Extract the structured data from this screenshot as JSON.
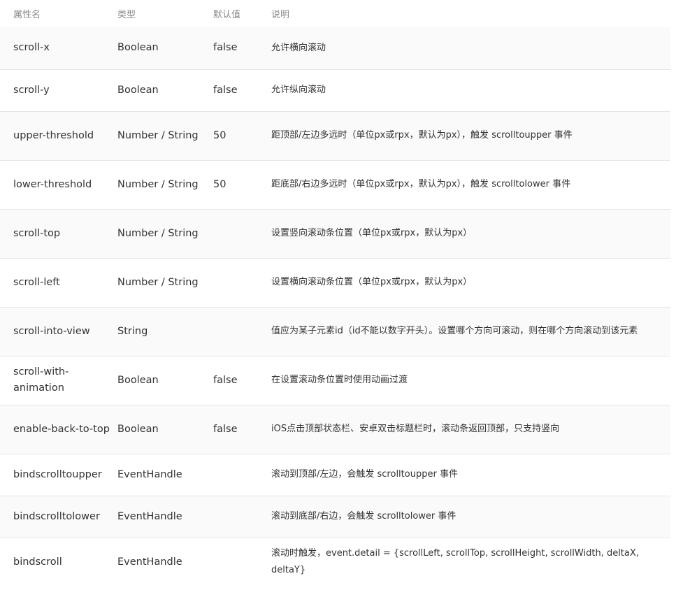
{
  "headers": {
    "name": "属性名",
    "type": "类型",
    "default": "默认值",
    "desc": "说明"
  },
  "rows": [
    {
      "name": "scroll-x",
      "type": "Boolean",
      "default": "false",
      "desc": "允许横向滚动"
    },
    {
      "name": "scroll-y",
      "type": "Boolean",
      "default": "false",
      "desc": "允许纵向滚动"
    },
    {
      "name": "upper-threshold",
      "type": "Number / String",
      "default": "50",
      "desc": "距顶部/左边多远时（单位px或rpx，默认为px），触发 scrolltoupper 事件"
    },
    {
      "name": "lower-threshold",
      "type": "Number / String",
      "default": "50",
      "desc": "距底部/右边多远时（单位px或rpx，默认为px），触发 scrolltolower 事件"
    },
    {
      "name": "scroll-top",
      "type": "Number / String",
      "default": "",
      "desc": "设置竖向滚动条位置（单位px或rpx，默认为px）"
    },
    {
      "name": "scroll-left",
      "type": "Number / String",
      "default": "",
      "desc": "设置横向滚动条位置（单位px或rpx，默认为px）"
    },
    {
      "name": "scroll-into-view",
      "type": "String",
      "default": "",
      "desc": "值应为某子元素id（id不能以数字开头）。设置哪个方向可滚动，则在哪个方向滚动到该元素"
    },
    {
      "name": "scroll-with-animation",
      "type": "Boolean",
      "default": "false",
      "desc": "在设置滚动条位置时使用动画过渡"
    },
    {
      "name": "enable-back-to-top",
      "type": "Boolean",
      "default": "false",
      "desc": "iOS点击顶部状态栏、安卓双击标题栏时，滚动条返回顶部，只支持竖向"
    },
    {
      "name": "bindscrolltoupper",
      "type": "EventHandle",
      "default": "",
      "desc": "滚动到顶部/左边，会触发 scrolltoupper 事件"
    },
    {
      "name": "bindscrolltolower",
      "type": "EventHandle",
      "default": "",
      "desc": "滚动到底部/右边，会触发 scrolltolower 事件"
    },
    {
      "name": "bindscroll",
      "type": "EventHandle",
      "default": "",
      "desc": "滚动时触发，event.detail = {scrollLeft, scrollTop, scrollHeight, scrollWidth, deltaX, deltaY}"
    }
  ]
}
